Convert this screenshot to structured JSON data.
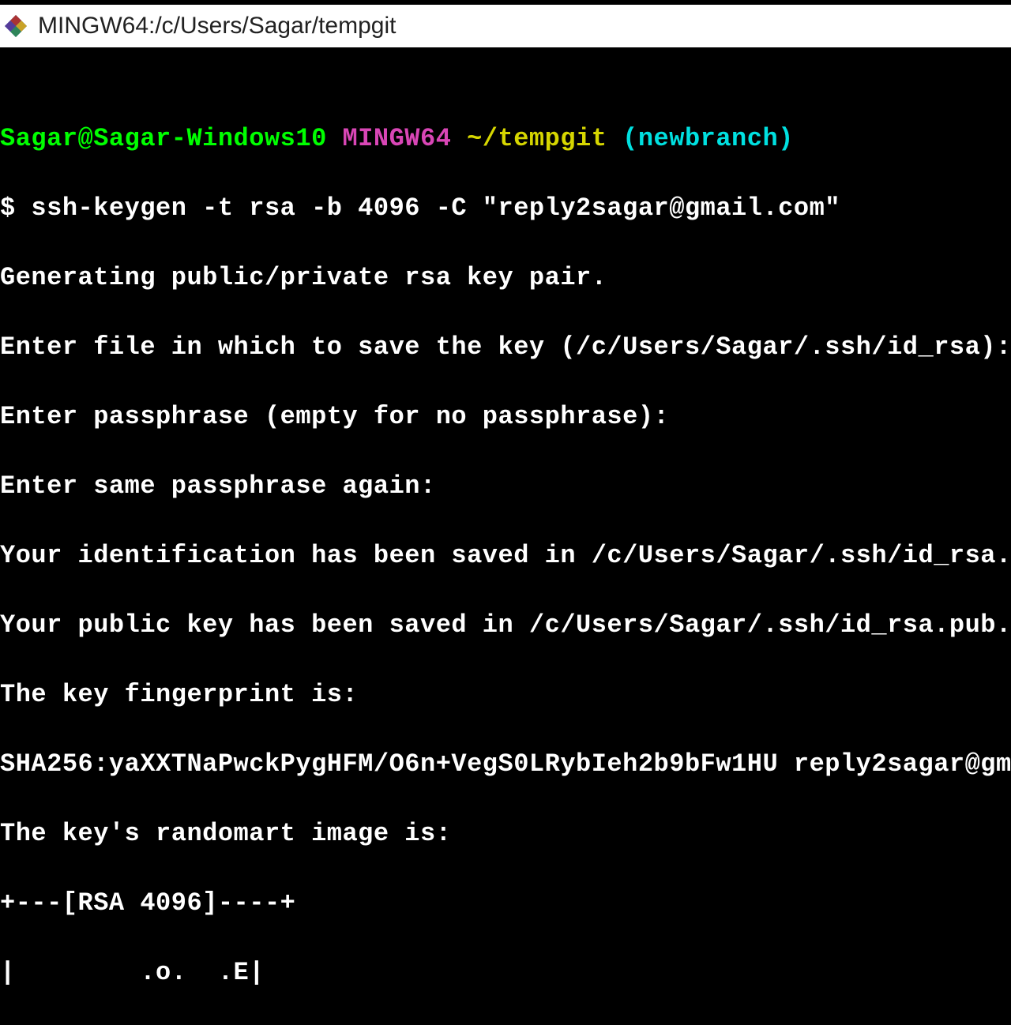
{
  "titlebar": {
    "text": "MINGW64:/c/Users/Sagar/tempgit"
  },
  "prompt": {
    "user": "Sagar@Sagar-Windows10",
    "env": "MINGW64",
    "path": "~/tempgit",
    "branch": "(newbranch)"
  },
  "lines": {
    "command": "$ ssh-keygen -t rsa -b 4096 -C \"reply2sagar@gmail.com\"",
    "l1": "Generating public/private rsa key pair.",
    "l2": "Enter file in which to save the key (/c/Users/Sagar/.ssh/id_rsa):",
    "l3": "Enter passphrase (empty for no passphrase):",
    "l4": "Enter same passphrase again:",
    "l5": "Your identification has been saved in /c/Users/Sagar/.ssh/id_rsa.",
    "l6": "Your public key has been saved in /c/Users/Sagar/.ssh/id_rsa.pub.",
    "l7": "The key fingerprint is:",
    "l8": "SHA256:yaXXTNaPwckPygHFM/O6n+VegS0LRybIeh2b9bFw1HU reply2sagar@gm",
    "l9": "The key's randomart image is:",
    "l10": "+---[RSA 4096]----+",
    "l11": "|        .o.  .E|"
  }
}
